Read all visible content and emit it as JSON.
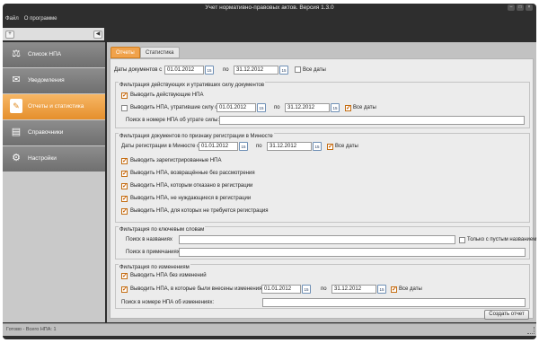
{
  "window": {
    "title": "Учет нормативно-правовых актов. Версия 1.3.0",
    "min": "–",
    "max": "□",
    "close": "×"
  },
  "menu": {
    "file": "Файл",
    "about": "О программе"
  },
  "left_toolbar": {
    "add": "+",
    "back": "◀"
  },
  "sidebar": {
    "items": [
      {
        "label": "Список НПА",
        "icon": "scales-icon"
      },
      {
        "label": "Уведомления",
        "icon": "letters-icon"
      },
      {
        "label": "Отчеты и статистика",
        "icon": "report-icon",
        "active": true
      },
      {
        "label": "Справочники",
        "icon": "book-icon"
      },
      {
        "label": "Настройки",
        "icon": "gears-icon"
      }
    ],
    "active_color": "#ee9a3c"
  },
  "tabs": [
    {
      "label": "Отчеты",
      "active": true
    },
    {
      "label": "Статистика",
      "active": false
    }
  ],
  "top": {
    "doc_dates_label": "Даты документов с",
    "from": "01.01.2012",
    "to_label": "по",
    "to": "31.12.2012",
    "all_dates": "Все даты"
  },
  "g1": {
    "title": "Фильтрация действующих и утративших силу документов",
    "show_active": "Выводить действующие НПА",
    "show_expired": "Выводить НПА, утратившие силу с",
    "from": "01.01.2012",
    "to_label": "по",
    "to": "31.12.2012",
    "all_dates": "Все даты",
    "search_label": "Поиск в номере НПА об утрате силы:"
  },
  "g2": {
    "title": "Фильтрация документов по признаку регистрации в Минюсте",
    "reg_label": "Даты регистрации в Минюсте с",
    "from": "01.01.2012",
    "to_label": "по",
    "to": "31.12.2012",
    "all_dates": "Все даты",
    "opts": [
      "Выводить зарегистрированные НПА",
      "Выводить НПА, возвращённые без рассмотрения",
      "Выводить НПА, которым отказано в регистрации",
      "Выводить НПА, не нуждающиеся в регистрации",
      "Выводить НПА, для которых не требуется регистрация"
    ]
  },
  "g3": {
    "title": "Фильтрация по ключевым словам",
    "names_label": "Поиск в названиях",
    "empty_names": "Только с пустым названием",
    "notes_label": "Поиск в примечаниях"
  },
  "g4": {
    "title": "Фильтрация по изменениям",
    "no_changes": "Выводить НПА без изменений",
    "with_changes": "Выводить НПА, в которые были внесены изменения с",
    "from": "01.01.2012",
    "to_label": "по",
    "to": "31.12.2012",
    "all_dates": "Все даты",
    "search_label": "Поиск в номере НПА об изменениях:"
  },
  "create_report": "Создать отчет",
  "status": "Готово - Всего НПА: 1",
  "calendar_glyph": "15"
}
